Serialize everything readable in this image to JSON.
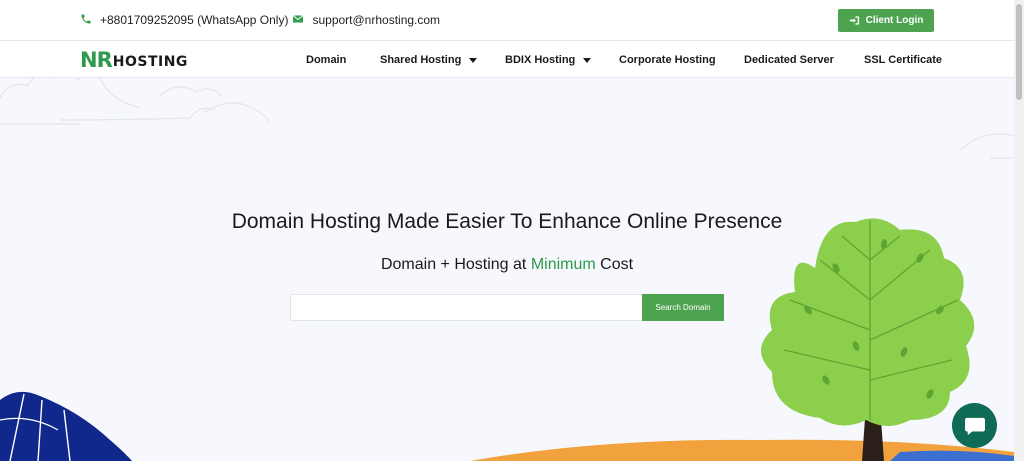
{
  "topbar": {
    "phone": "+8801709252095 (WhatsApp Only)",
    "email": "support@nrhosting.com",
    "login_label": "Client Login"
  },
  "logo": {
    "part1": "NR",
    "part2": "HOSTING"
  },
  "nav": {
    "items": [
      {
        "label": "Domain",
        "dropdown": false
      },
      {
        "label": "Shared Hosting",
        "dropdown": true
      },
      {
        "label": "BDIX Hosting",
        "dropdown": true
      },
      {
        "label": "Corporate Hosting",
        "dropdown": false
      },
      {
        "label": "Dedicated Server",
        "dropdown": false
      },
      {
        "label": "SSL Certificate",
        "dropdown": false
      }
    ]
  },
  "hero": {
    "title": "Domain Hosting Made Easier To Enhance Online Presence",
    "subtitle_before": "Domain + Hosting at ",
    "subtitle_accent": "Minimum",
    "subtitle_after": " Cost"
  },
  "search": {
    "value": "",
    "placeholder": "",
    "button_label": "Search Domain"
  },
  "icons": {
    "phone": "phone-icon",
    "email": "envelope-icon",
    "login": "sign-in-icon",
    "chat": "chat-bubble-icon"
  },
  "colors": {
    "brand_green": "#4ea350",
    "accent_green": "#2f9a4b",
    "chat_bg": "#0f6b55",
    "wave_blue": "#10288c",
    "tree_leaf": "#8ccf4c",
    "ground_orange": "#f2a23c"
  }
}
